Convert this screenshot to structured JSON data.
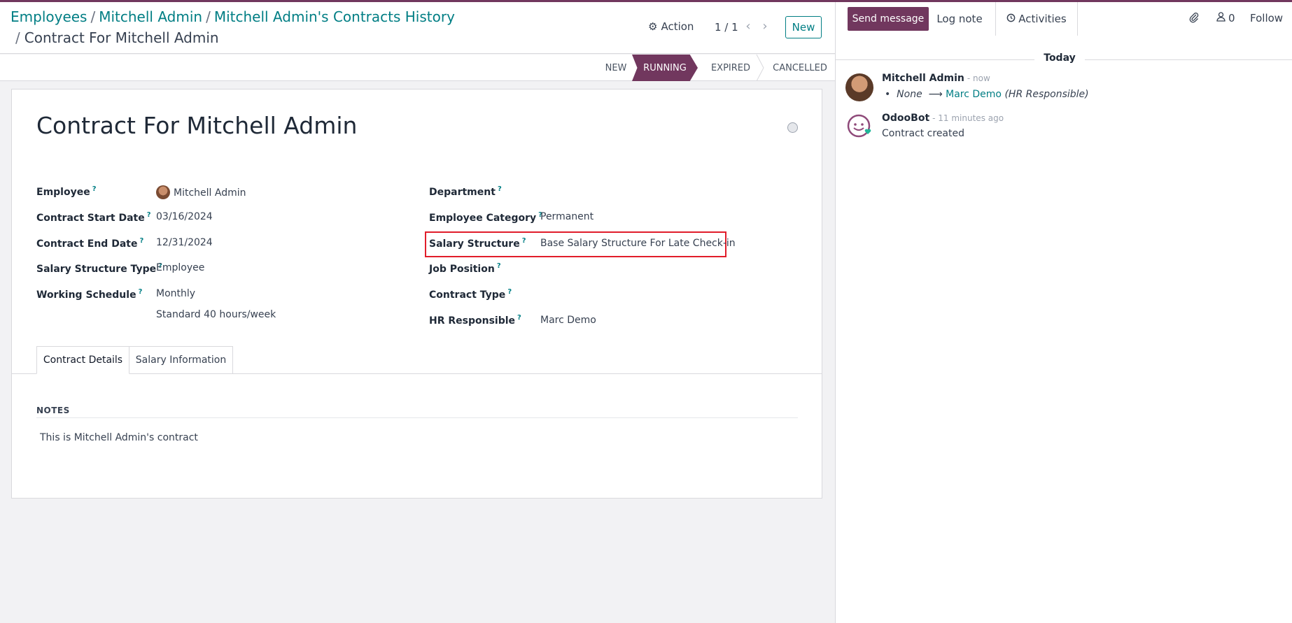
{
  "breadcrumb": {
    "items": [
      "Employees",
      "Mitchell Admin",
      "Mitchell Admin's Contracts History"
    ],
    "separator": "/",
    "current": "Contract For Mitchell Admin"
  },
  "control_panel": {
    "action_label": "Action",
    "pager": "1 / 1",
    "new_label": "New"
  },
  "statusbar": {
    "stages": [
      "NEW",
      "RUNNING",
      "EXPIRED",
      "CANCELLED"
    ],
    "active": "RUNNING"
  },
  "form": {
    "title": "Contract For Mitchell Admin",
    "help_mark": "?",
    "left": [
      {
        "label": "Employee",
        "value": "Mitchell Admin"
      },
      {
        "label": "Contract Start Date",
        "value": "03/16/2024"
      },
      {
        "label": "Contract End Date",
        "value": "12/31/2024"
      },
      {
        "label": "Salary Structure Type",
        "value": "Employee"
      },
      {
        "label": "Working Schedule",
        "value": "Monthly",
        "value2": "Standard 40 hours/week"
      }
    ],
    "right": [
      {
        "label": "Department",
        "value": ""
      },
      {
        "label": "Employee Category",
        "value": "Permanent"
      },
      {
        "label": "Salary Structure",
        "value": "Base Salary Structure For Late Check-in"
      },
      {
        "label": "Job Position",
        "value": ""
      },
      {
        "label": "Contract Type",
        "value": ""
      },
      {
        "label": "HR Responsible",
        "value": "Marc Demo"
      }
    ],
    "tabs": [
      "Contract Details",
      "Salary Information"
    ],
    "notes_label": "NOTES",
    "notes_text": "This is Mitchell Admin's contract"
  },
  "chatter": {
    "send_message": "Send message",
    "log_note": "Log note",
    "activities": "Activities",
    "followers_count": "0",
    "follow": "Follow",
    "today": "Today",
    "messages": [
      {
        "author": "Mitchell Admin",
        "time": "- now",
        "old": "None",
        "new": "Marc Demo",
        "field": "(HR Responsible)"
      },
      {
        "author": "OdooBot",
        "time": "- 11 minutes ago",
        "body": "Contract created"
      }
    ]
  },
  "colors": {
    "brand": "#71375e",
    "link": "#017e84",
    "highlight": "#e11d2a"
  }
}
